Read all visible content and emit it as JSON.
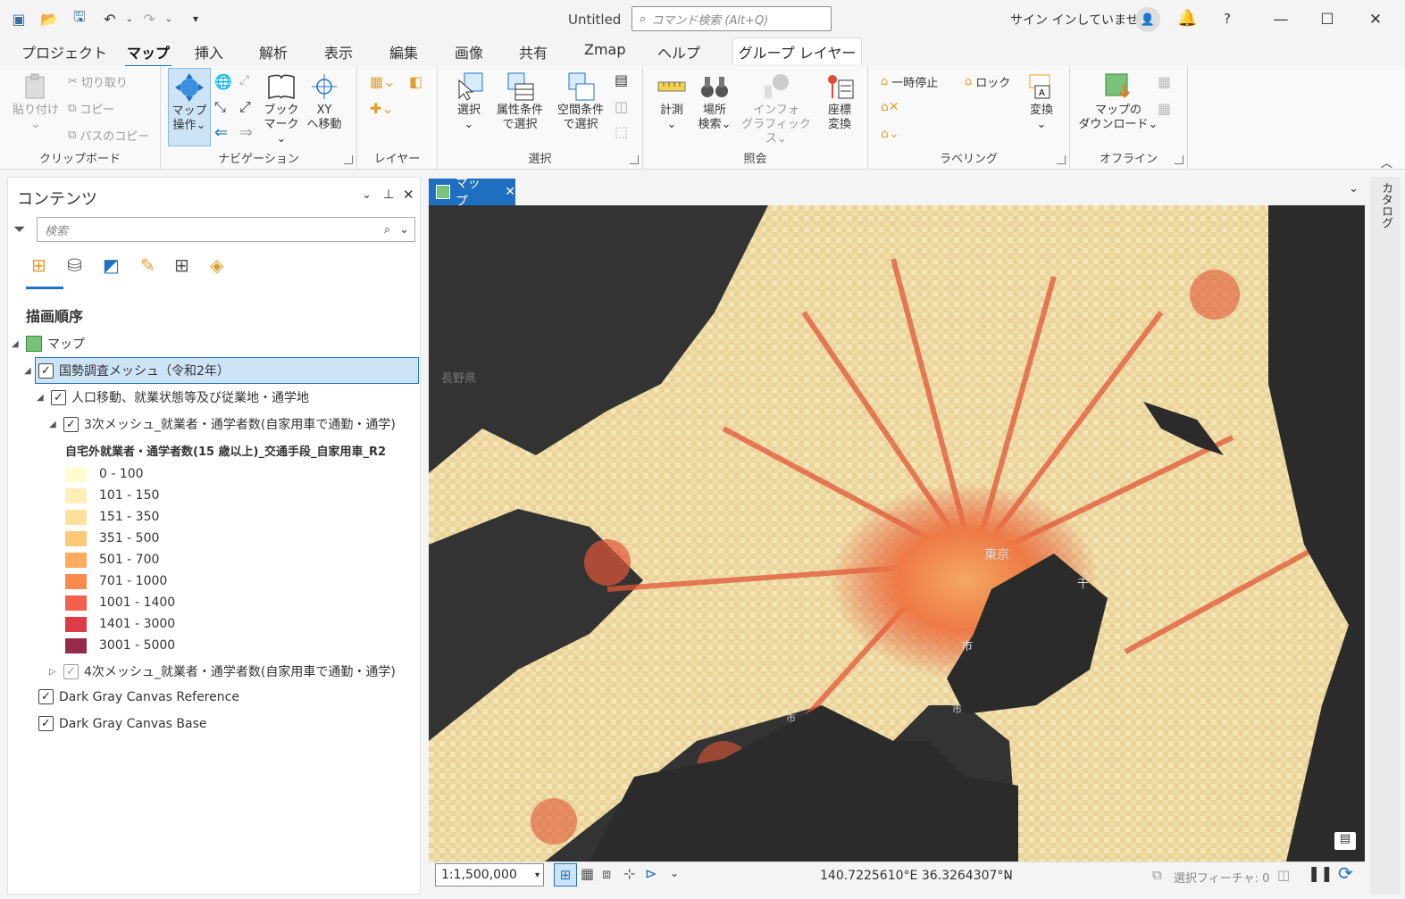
{
  "titlebar": {
    "title": "Untitled",
    "search_placeholder": "コマンド検索 (Alt+Q)",
    "signin": "サイン インしていません",
    "help": "?"
  },
  "tabs": [
    "プロジェクト",
    "マップ",
    "挿入",
    "解析",
    "表示",
    "編集",
    "画像",
    "共有",
    "Zmap",
    "ヘルプ"
  ],
  "context_tab": "グループ レイヤー",
  "ribbon": {
    "clipboard": {
      "paste": "貼り付け",
      "cut": "切り取り",
      "copy": "コピー",
      "copy_path": "パスのコピー",
      "label": "クリップボード"
    },
    "navigation": {
      "explore_1": "マップ",
      "explore_2": "操作",
      "bookmark_1": "ブック",
      "bookmark_2": "マーク",
      "xy_1": "XY",
      "xy_2": "へ移動",
      "label": "ナビゲーション"
    },
    "layer": {
      "label": "レイヤー"
    },
    "selection": {
      "select": "選択",
      "by_attr_1": "属性条件",
      "by_attr_2": "で選択",
      "by_loc_1": "空間条件",
      "by_loc_2": "で選択",
      "label": "選択"
    },
    "inquiry": {
      "measure": "計測",
      "locate_1": "場所",
      "locate_2": "検索",
      "infographics_1": "インフォ",
      "infographics_2": "グラフィックス",
      "convert_1": "座標",
      "convert_2": "変換",
      "label": "照会"
    },
    "labeling": {
      "pause": "一時停止",
      "lock": "ロック",
      "convert": "変換",
      "label": "ラベリング"
    },
    "offline": {
      "download_1": "マップの",
      "download_2": "ダウンロード",
      "label": "オフライン"
    }
  },
  "contents": {
    "title": "コンテンツ",
    "search_placeholder": "検索",
    "section": "描画順序",
    "map": "マップ",
    "group_layer": "国勢調査メッシュ（令和2年）",
    "sub_group": "人口移動、就業状態等及び従業地・通学地",
    "layer3": "3次メッシュ_就業者・通学者数(自家用車で通勤・通学)",
    "field": "自宅外就業者・通学者数(15 歳以上)_交通手段_自家用車_R2",
    "legend": [
      {
        "label": "0 - 100",
        "color": "#fffcd0"
      },
      {
        "label": "101 - 150",
        "color": "#fdefb5"
      },
      {
        "label": "151 - 350",
        "color": "#fde09a"
      },
      {
        "label": "351 - 500",
        "color": "#fdc878"
      },
      {
        "label": "501 - 700",
        "color": "#fcab5f"
      },
      {
        "label": "701 - 1000",
        "color": "#fb8a4e"
      },
      {
        "label": "1001 - 1400",
        "color": "#f4604a"
      },
      {
        "label": "1401 - 3000",
        "color": "#dd3c46"
      },
      {
        "label": "3001 - 5000",
        "color": "#962a4a"
      }
    ],
    "layer4": "4次メッシュ_就業者・通学者数(自家用車で通勤・通学)",
    "ref": "Dark Gray Canvas Reference",
    "base": "Dark Gray Canvas Base"
  },
  "map": {
    "tab": "マップ",
    "labels": [
      "長野県",
      "東京",
      "千",
      "市",
      "市",
      "市"
    ],
    "scale": "1:1,500,000",
    "coords": "140.7225610°E 36.3264307°N",
    "selected_features": "選択フィーチャ: 0"
  },
  "catalog": "カタログ"
}
